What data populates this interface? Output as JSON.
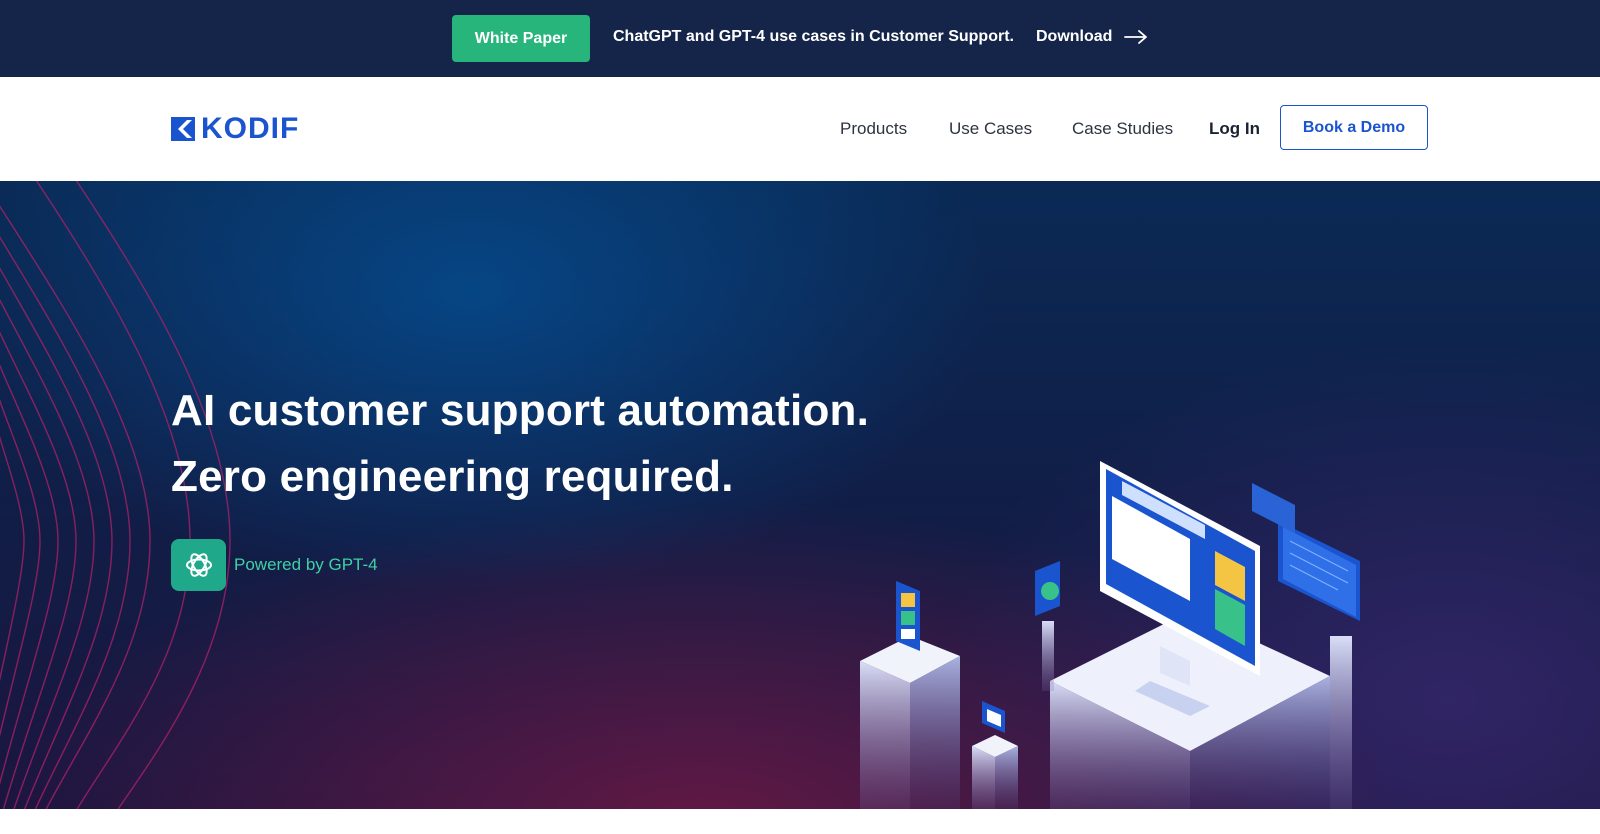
{
  "announcement": {
    "badge_label": "White Paper",
    "text": "ChatGPT and GPT-4 use cases in Customer Support.",
    "link_label": "Download",
    "link_icon": "arrow-right-icon",
    "bg_color": "#15254a",
    "badge_color": "#28b57c"
  },
  "nav": {
    "logo_text": "KODIF",
    "logo_icon": "kodif-k-icon",
    "brand_color": "#1a55cf",
    "items": [
      {
        "label": "Products"
      },
      {
        "label": "Use Cases"
      },
      {
        "label": "Case Studies"
      }
    ],
    "login_label": "Log In",
    "cta_label": "Book a Demo"
  },
  "hero": {
    "headline_line1": "AI customer support automation.",
    "headline_line2": "Zero engineering required.",
    "powered_icon": "openai-logo-icon",
    "powered_label": "Powered by GPT-4",
    "accent_color": "#1fa98a",
    "illustration": "isometric-support-platform-illustration"
  }
}
